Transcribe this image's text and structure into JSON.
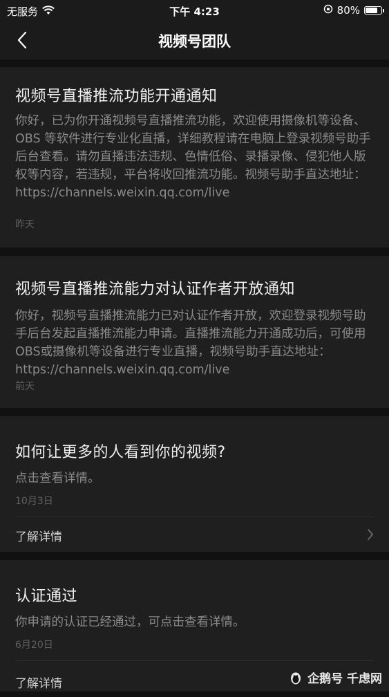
{
  "status_bar": {
    "carrier": "无服务",
    "time": "下午 4:23",
    "battery": "80%",
    "battery_level": 0.8
  },
  "nav": {
    "title": "视频号团队",
    "back_icon": "chevron-left-icon"
  },
  "messages": [
    {
      "title": "视频号直播推流功能开通通知",
      "body": "你好，已为你开通视频号直播推流功能，欢迎使用摄像机等设备、OBS 等软件进行专业化直播，详细教程请在电脑上登录视频号助手后台查看。请勿直播违法违规、色情低俗、录播录像、侵犯他人版权等内容，若违规，平台将收回推流功能。视频号助手直达地址：https://channels.weixin.qq.com/live",
      "date": "昨天"
    },
    {
      "title": "视频号直播推流能力对认证作者开放通知",
      "body": "你好，视频号直播推流能力已对认证作者开放，欢迎登录视频号助手后台发起直播推流能力申请。直播推流能力开通成功后，可使用OBS或摄像机等设备进行专业直播，视频号助手直达地址：https://channels.weixin.qq.com/live",
      "date": "前天"
    },
    {
      "title": "如何让更多的人看到你的视频?",
      "body": "点击查看详情。",
      "date": "10月3日",
      "more_label": "了解详情"
    },
    {
      "title": "认证通过",
      "body": "你申请的认证已经通过，可点击查看详情。",
      "date": "6月20日",
      "more_label": "了解详情"
    }
  ],
  "watermark": {
    "text": "企鹅号 千虑网"
  },
  "colors": {
    "background": "#111111",
    "card": "#1f1f1f",
    "title_text": "#f0f0f0",
    "body_text": "#8a8a8a"
  }
}
